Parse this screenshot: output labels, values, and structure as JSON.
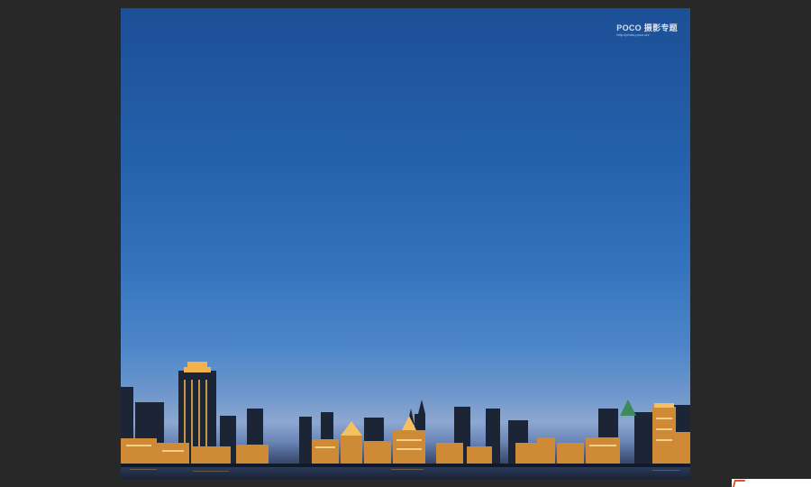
{
  "window": {
    "background": "#282828"
  },
  "photo": {
    "subject": "",
    "sky_colors": [
      "#1c4f96",
      "#4d86c8",
      "#8da7d0"
    ],
    "watermark": {
      "brand": "POCO 摄影专题",
      "url": "http://photo.poco.cn/"
    }
  },
  "corner_logo": {
    "icon": "site-logo-icon",
    "accent": "#e0522b"
  }
}
